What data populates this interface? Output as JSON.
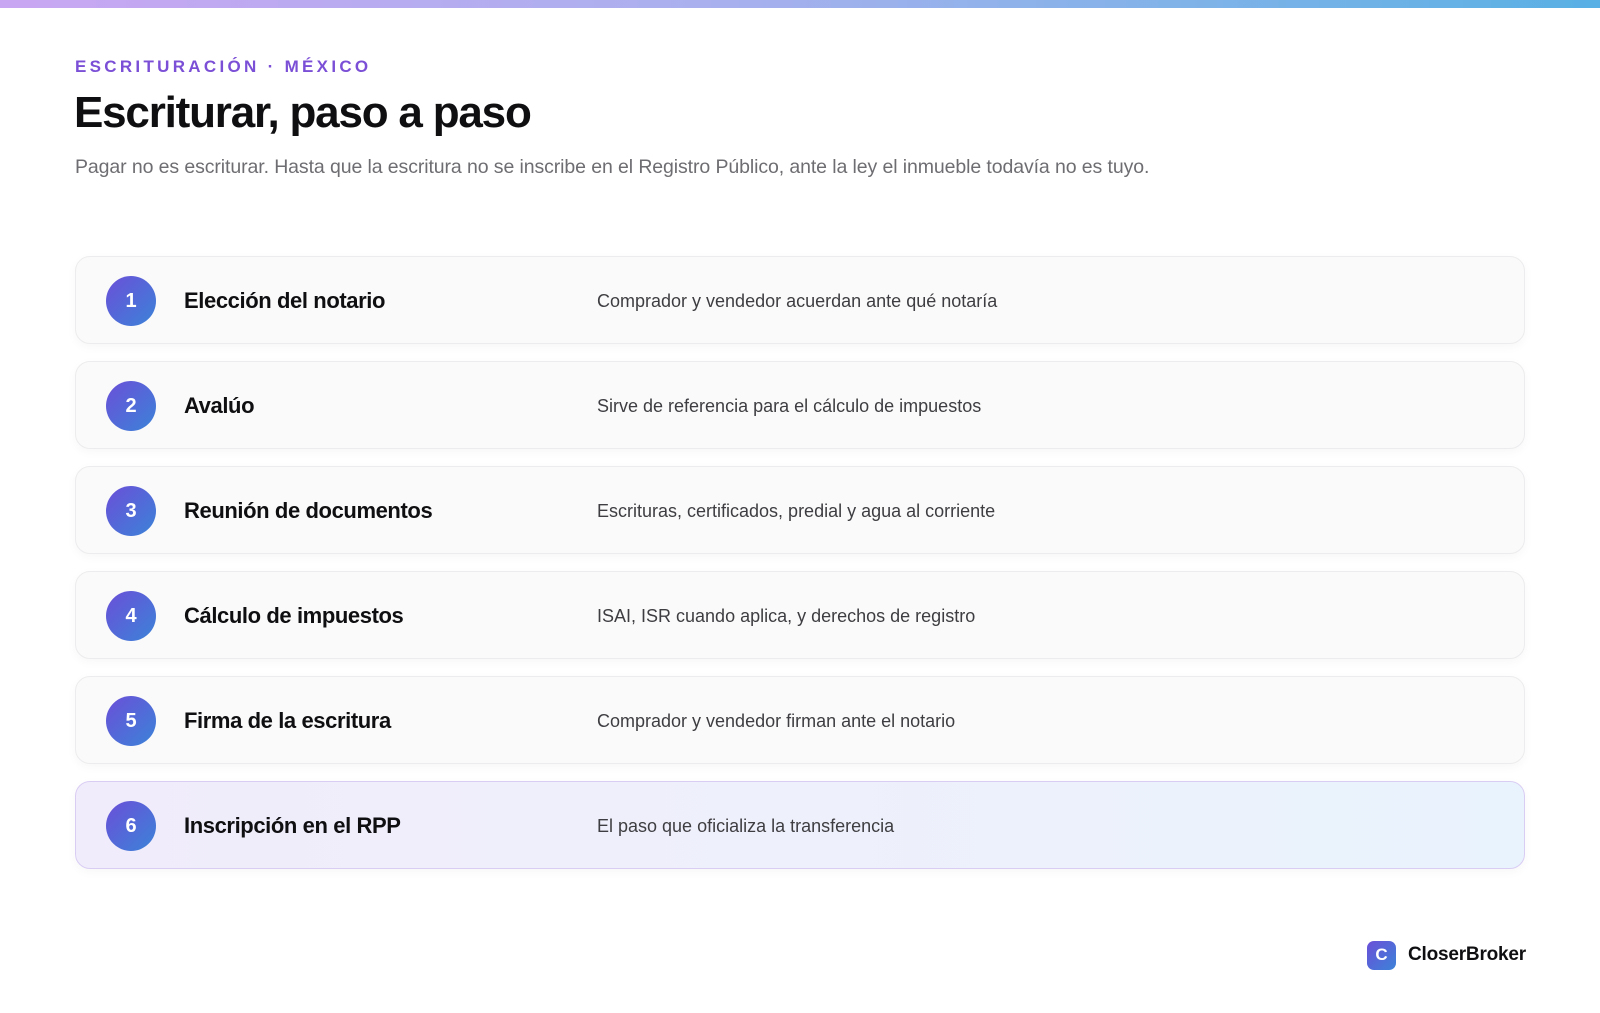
{
  "header": {
    "eyebrow": "ESCRITURACIÓN · MÉXICO",
    "title": "Escriturar, paso a paso",
    "subtitle": "Pagar no es escriturar. Hasta que la escritura no se inscribe en el Registro Público, ante la ley el inmueble todavía no es tuyo."
  },
  "steps": [
    {
      "number": "1",
      "title": "Elección del notario",
      "description": "Comprador y vendedor acuerdan ante qué notaría"
    },
    {
      "number": "2",
      "title": "Avalúo",
      "description": "Sirve de referencia para el cálculo de impuestos"
    },
    {
      "number": "3",
      "title": "Reunión de documentos",
      "description": "Escrituras, certificados, predial y agua al corriente"
    },
    {
      "number": "4",
      "title": "Cálculo de impuestos",
      "description": "ISAI, ISR cuando aplica, y derechos de registro"
    },
    {
      "number": "5",
      "title": "Firma de la escritura",
      "description": "Comprador y vendedor firman ante el notario"
    },
    {
      "number": "6",
      "title": "Inscripción en el RPP",
      "description": "El paso que oficializa la transferencia"
    }
  ],
  "brand": {
    "icon_letter": "C",
    "name": "CloserBroker"
  },
  "colors": {
    "accent": "#7b4fd6",
    "gradient_start": "#6b4fd8",
    "gradient_end": "#3b83d8"
  }
}
